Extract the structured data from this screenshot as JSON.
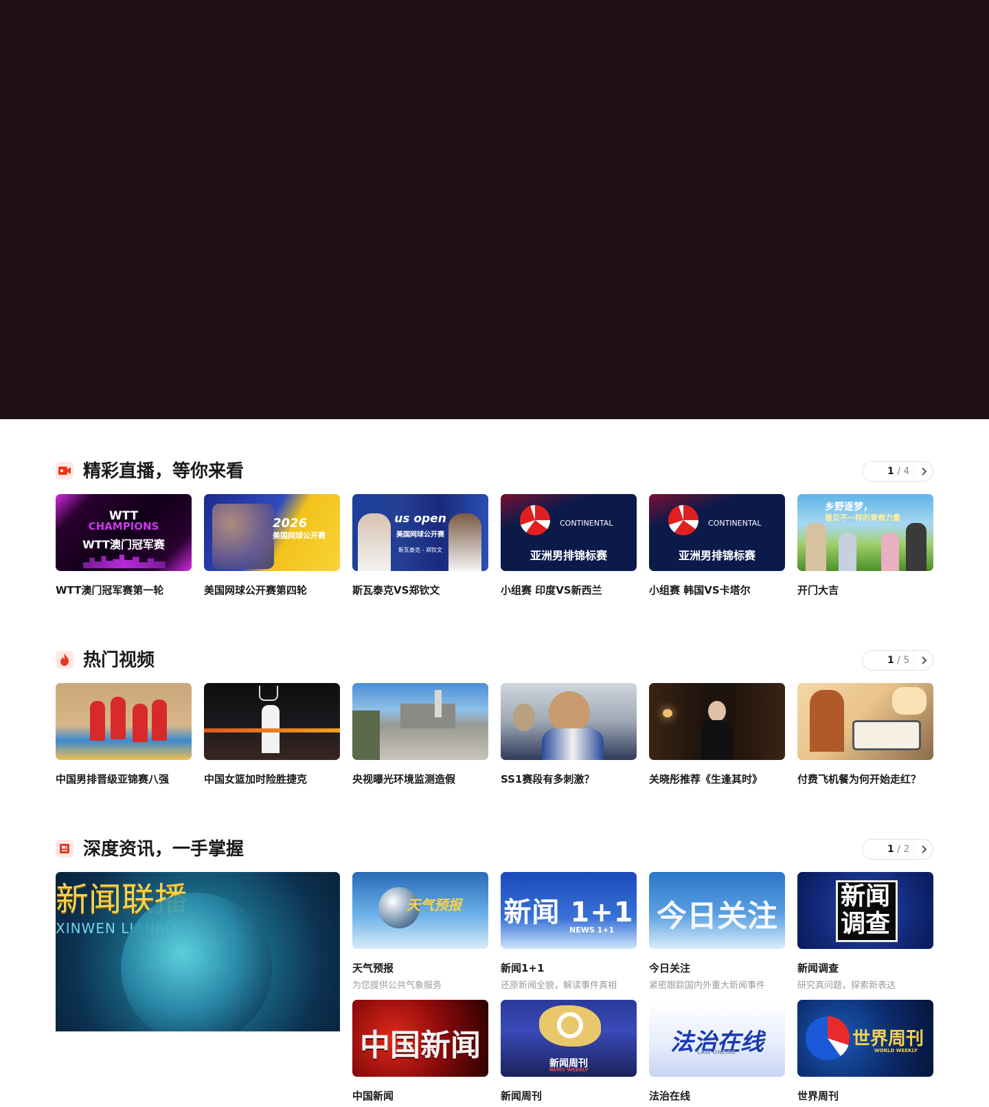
{
  "sections": [
    {
      "title": "精彩直播，等你来看",
      "pager": {
        "current": "1",
        "total": "/ 4"
      },
      "items": [
        {
          "title": "WTT澳门冠军赛第一轮",
          "thumb_text": [
            "WTT",
            "CHAMPIONS",
            "WTT澳门冠军赛"
          ]
        },
        {
          "title": "美国网球公开赛第四轮",
          "thumb_text": [
            "2026",
            "美国网球公开赛"
          ]
        },
        {
          "title": "斯瓦泰克VS郑钦文",
          "thumb_text": [
            "us open",
            "美国网球公开赛",
            "斯瓦泰克 - 郑钦文"
          ]
        },
        {
          "title": "小组赛 印度VS新西兰",
          "thumb_text": [
            "CONTINENTAL",
            "亚洲男排锦标赛"
          ]
        },
        {
          "title": "小组赛 韩国VS卡塔尔",
          "thumb_text": [
            "CONTINENTAL",
            "亚洲男排锦标赛"
          ]
        },
        {
          "title": "开门大吉",
          "thumb_text": [
            "乡野逐梦，",
            "看见不一样的青春力量"
          ]
        }
      ]
    },
    {
      "title": "热门视频",
      "pager": {
        "current": "1",
        "total": "/ 5"
      },
      "items": [
        {
          "title": "中国男排晋级亚锦赛八强"
        },
        {
          "title": "中国女篮加时险胜捷克"
        },
        {
          "title": "央视曝光环境监测造假"
        },
        {
          "title": "SS1赛段有多刺激？"
        },
        {
          "title": "关晓彤推荐《生逢其时》"
        },
        {
          "title": "付费飞机餐为何开始走红？"
        }
      ]
    },
    {
      "title": "深度资讯，一手掌握",
      "pager": {
        "current": "1",
        "total": "/ 2"
      },
      "featured": {
        "thumb_text": [
          "新闻联播",
          "XINWEN LIANBO"
        ]
      },
      "items": [
        {
          "title": "天气预报",
          "subtitle": "为您提供公共气象服务",
          "thumb_text": "天气预报"
        },
        {
          "title": "新闻1+1",
          "subtitle": "还原新闻全貌，解读事件真相",
          "thumb_text": "新闻 1+1",
          "thumb_sub": "NEWS 1+1"
        },
        {
          "title": "今日关注",
          "subtitle": "紧密跟踪国内外重大新闻事件",
          "thumb_text": "今日关注"
        },
        {
          "title": "新闻调查",
          "subtitle": "研究真问题，探索新表达",
          "thumb_text": [
            "新闻",
            "调查"
          ]
        },
        {
          "title": "中国新闻",
          "thumb_text": "中国新闻"
        },
        {
          "title": "新闻周刊",
          "thumb_text": "新闻周刊",
          "thumb_sub": "NEWS WEEKLY"
        },
        {
          "title": "法治在线",
          "thumb_text": "法治在线",
          "thumb_sub": "LAW ONLINE"
        },
        {
          "title": "世界周刊",
          "thumb_text": "世界周刊",
          "thumb_sub": "WORLD WEEKLY"
        }
      ]
    }
  ],
  "colors": {
    "hero": "#231016",
    "accent": "#e8361e"
  },
  "icons": [
    "live-video-icon",
    "fire-icon",
    "news-icon",
    "chevron-right-icon"
  ]
}
